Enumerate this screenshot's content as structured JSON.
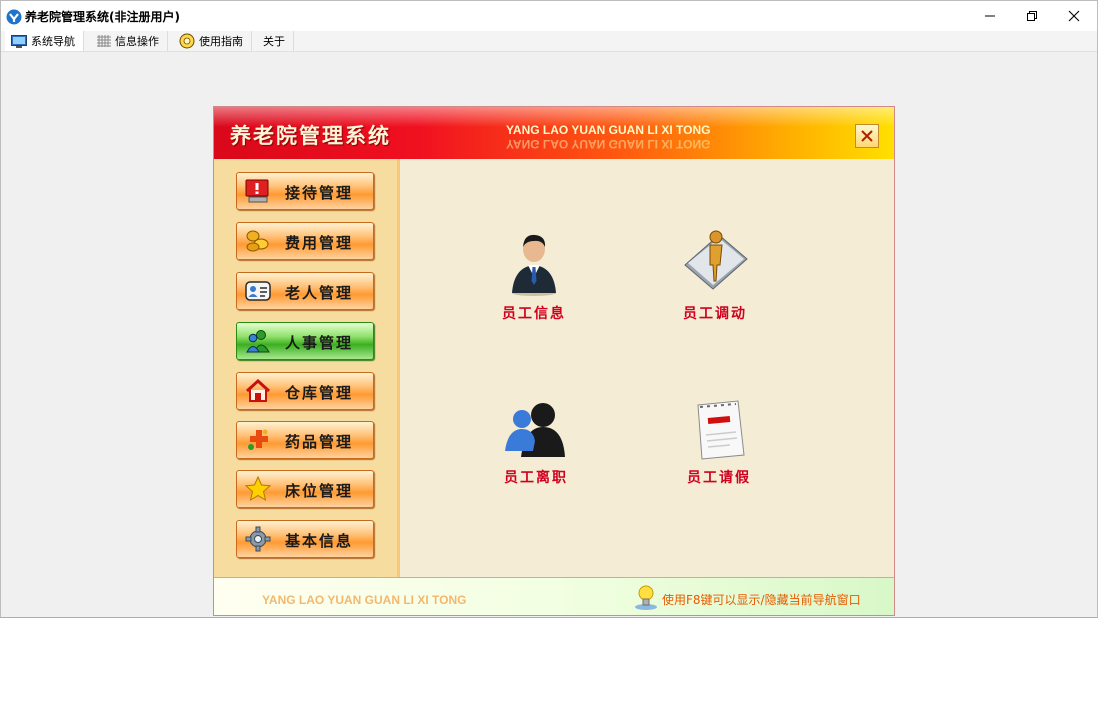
{
  "window": {
    "title": "养老院管理系统(非注册用户)",
    "controls": [
      "minimize-icon",
      "restore-icon",
      "close-icon"
    ]
  },
  "menubar": {
    "items": [
      {
        "label": "系统导航",
        "icon": "monitor-icon",
        "active": true
      },
      {
        "label": "信息操作",
        "icon": "grid-icon",
        "active": false
      },
      {
        "label": "使用指南",
        "icon": "guide-icon",
        "active": false
      },
      {
        "label": "关于",
        "icon": "",
        "active": false
      }
    ]
  },
  "panel": {
    "title": "养老院管理系统",
    "subtitle_en": "YANG LAO YUAN GUAN LI XI TONG",
    "close_icon": "close-icon"
  },
  "sidebar": {
    "items": [
      {
        "label": "接待管理",
        "icon": "reception-icon"
      },
      {
        "label": "费用管理",
        "icon": "coins-icon"
      },
      {
        "label": "老人管理",
        "icon": "id-card-icon"
      },
      {
        "label": "人事管理",
        "icon": "users-icon",
        "active": true
      },
      {
        "label": "仓库管理",
        "icon": "home-icon"
      },
      {
        "label": "药品管理",
        "icon": "medicine-icon"
      },
      {
        "label": "床位管理",
        "icon": "star-icon"
      },
      {
        "label": "基本信息",
        "icon": "gear-icon"
      }
    ]
  },
  "functions": {
    "items": [
      {
        "label": "员工信息",
        "icon": "businessman-icon"
      },
      {
        "label": "员工调动",
        "icon": "transfer-icon"
      },
      {
        "label": "员工离职",
        "icon": "user-group-icon"
      },
      {
        "label": "员工请假",
        "icon": "leave-calendar-icon"
      }
    ]
  },
  "footer": {
    "subtitle_en": "YANG LAO YUAN GUAN LI XI TONG",
    "hint": "使用F8键可以显示/隐藏当前导航窗口",
    "hint_icon": "lightbulb-icon"
  },
  "colors": {
    "banner_red": "#e8101c",
    "banner_yellow": "#ffe000",
    "function_label": "#d0001e",
    "hint_text": "#e85a00",
    "active_nav": "#3caf20"
  }
}
